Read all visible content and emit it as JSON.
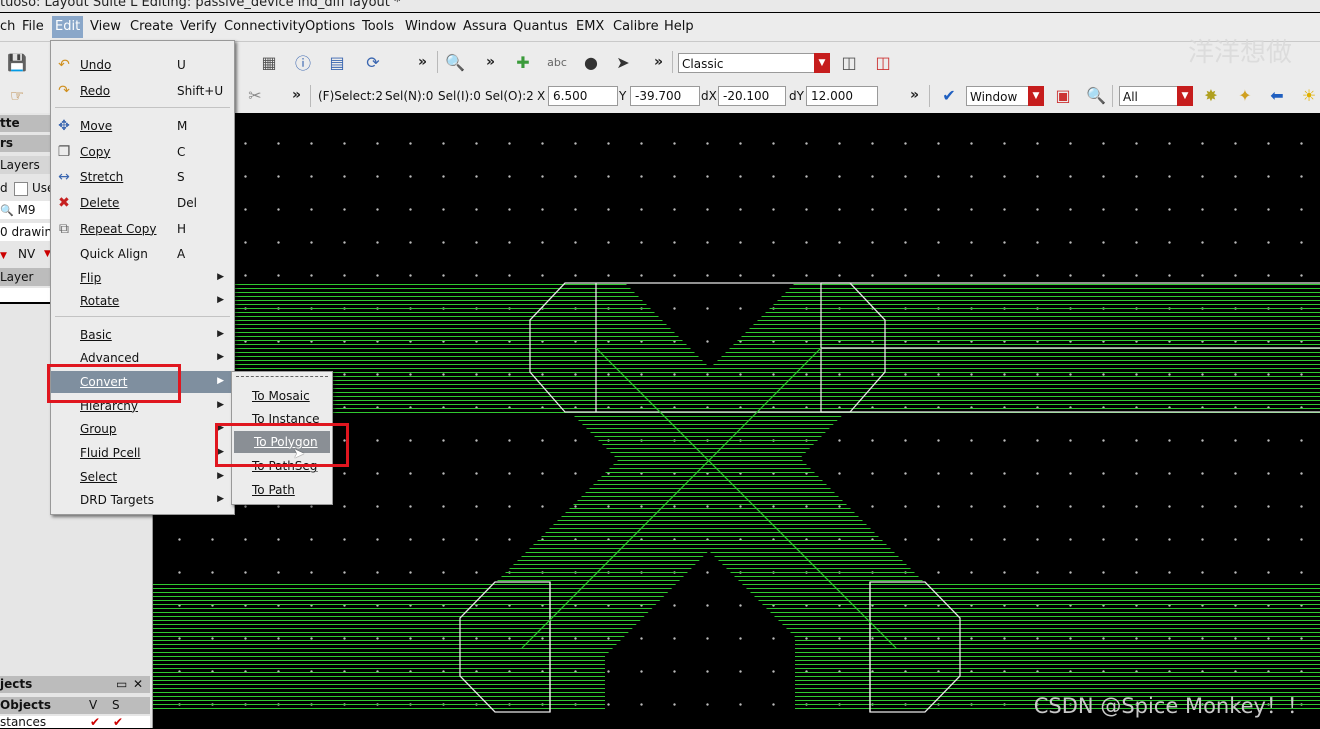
{
  "window": {
    "title": "tuoso: Layout Suite L Editing: passive_device ind_diff layout *"
  },
  "menubar": [
    "ch",
    "File",
    "Edit",
    "View",
    "Create",
    "Verify",
    "Connectivity",
    "Options",
    "Tools",
    "Window",
    "Assura",
    "Quantus",
    "EMX",
    "Calibre",
    "Help"
  ],
  "toolbar1": {
    "mode_combo": "Classic"
  },
  "toolbar2": {
    "fselect": "(F)Select:2",
    "sel_n": "Sel(N):0",
    "sel_i": "Sel(I):0",
    "sel_o": "Sel(O):2",
    "x_label": "X",
    "x_value": "6.500",
    "y_label": "Y",
    "y_value": "-39.700",
    "dx_label": "dX",
    "dx_value": "-20.100",
    "dy_label": "dY",
    "dy_value": "12.000",
    "window_combo": "Window",
    "filter_combo": "All"
  },
  "left_panel": {
    "palette_title": "tte",
    "layers_header": "rs",
    "layers_tab": "Layers",
    "used_label": "d",
    "used_check": "Use",
    "search_value": "M9",
    "drawing_label": "0 drawing",
    "nv_label": "NV",
    "layer_col": "Layer",
    "objects_title": "jects",
    "objects_col": "Objects",
    "v_col": "V",
    "s_col": "S",
    "instances_row": "stances"
  },
  "edit_menu": {
    "items": [
      {
        "icon": "undo-icon",
        "label": "Undo",
        "shortcut": "U"
      },
      {
        "icon": "redo-icon",
        "label": "Redo",
        "shortcut": "Shift+U"
      },
      {
        "icon": "move-icon",
        "label": "Move",
        "shortcut": "M"
      },
      {
        "icon": "copy-icon",
        "label": "Copy",
        "shortcut": "C"
      },
      {
        "icon": "stretch-icon",
        "label": "Stretch",
        "shortcut": "S"
      },
      {
        "icon": "delete-icon",
        "label": "Delete",
        "shortcut": "Del"
      },
      {
        "icon": "repeat-copy-icon",
        "label": "Repeat Copy",
        "shortcut": "H"
      },
      {
        "icon": "",
        "label": "Quick Align",
        "shortcut": "A"
      },
      {
        "icon": "",
        "label": "Flip",
        "shortcut": ""
      },
      {
        "icon": "",
        "label": "Rotate",
        "shortcut": ""
      },
      {
        "icon": "",
        "label": "Basic",
        "shortcut": ""
      },
      {
        "icon": "",
        "label": "Advanced",
        "shortcut": ""
      },
      {
        "icon": "",
        "label": "Convert",
        "shortcut": ""
      },
      {
        "icon": "",
        "label": "Hierarchy",
        "shortcut": ""
      },
      {
        "icon": "",
        "label": "Group",
        "shortcut": ""
      },
      {
        "icon": "",
        "label": "Fluid Pcell",
        "shortcut": ""
      },
      {
        "icon": "",
        "label": "Select",
        "shortcut": ""
      },
      {
        "icon": "",
        "label": "DRD Targets",
        "shortcut": ""
      }
    ]
  },
  "convert_submenu": [
    "To Mosaic",
    "To Instance",
    "To Polygon",
    "To PathSeg",
    "To Path"
  ],
  "colors": {
    "layout_green": "#2fc92f",
    "highlight_red": "#e0161f",
    "menu_highlight": "#7f8f9f"
  },
  "watermark": "CSDN @Spice Monkey！！",
  "overlay_chinese": "洋洋想做"
}
